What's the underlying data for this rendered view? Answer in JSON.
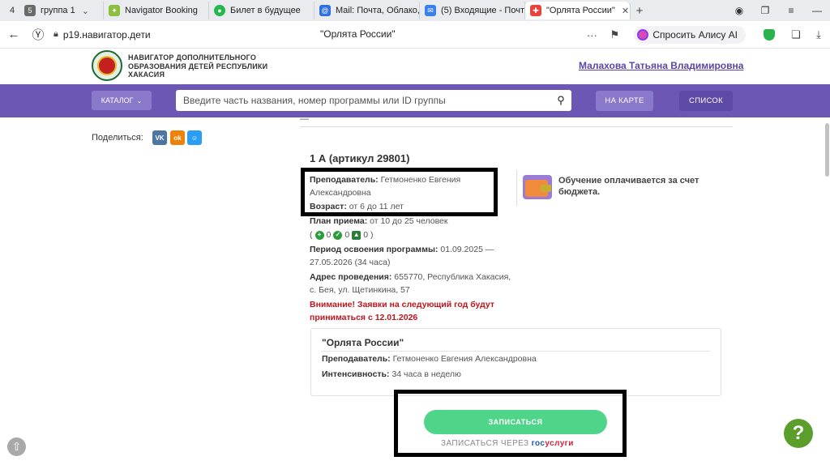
{
  "browser": {
    "tab_counter": "4",
    "tabs": [
      {
        "label": "группа 1",
        "badge": "5",
        "color": "#6a6a6a"
      },
      {
        "label": "Navigator Booking",
        "badge": "",
        "color": "#8bbf3c"
      },
      {
        "label": "Билет в будущее",
        "badge": "",
        "color": "#22b94a"
      },
      {
        "label": "Mail: Почта, Облако, К",
        "badge": "",
        "color": "#2f6fe5"
      },
      {
        "label": "(5) Входящие - Почта",
        "badge": "",
        "color": "#3b7fea"
      },
      {
        "label": "\"Орлята России\"",
        "badge": "",
        "color": "#e8443a"
      }
    ],
    "url": "p19.навигатор.дети",
    "page_title": "\"Орлята России\"",
    "alice_label": "Спросить Алису AI"
  },
  "header": {
    "org_name": "НАВИГАТОР ДОПОЛНИТЕЛЬНОГО\nОБРАЗОВАНИЯ ДЕТЕЙ РЕСПУБЛИКИ\nХАКАСИЯ",
    "user_name": "Малахова Татьяна Владимировна"
  },
  "nav": {
    "catalog_label": "КАТАЛОГ",
    "search_placeholder": "Введите часть названия, номер программы или ID группы",
    "map_label": "НА КАРТЕ",
    "list_label": "СПИСОК"
  },
  "share": {
    "label": "Поделиться:",
    "networks": [
      {
        "icon": "VK",
        "color": "#4c75a3"
      },
      {
        "icon": "ok",
        "color": "#ee8208"
      },
      {
        "icon": "☺",
        "color": "#2a9df4"
      }
    ]
  },
  "group": {
    "title": "1 А (артикул 29801)",
    "teacher_label": "Преподаватель:",
    "teacher": "Гетмоненко Евгения Александровна",
    "age_label": "Возраст:",
    "age": "от 6 до 11 лет",
    "plan_label": "План приема:",
    "plan": "от 10 до 25 человек",
    "plan_counts": [
      "0",
      "0",
      "0"
    ],
    "period_label": "Период освоения программы:",
    "period": "01.09.2025 — 27.05.2026 (34 часа)",
    "address_label": "Адрес проведения:",
    "address": "655770, Республика Хакасия, с. Бея, ул. Щетинкина, 57",
    "warning": "Внимание! Заявки на следующий год будут приниматься с 12.01.2026"
  },
  "payment": {
    "text": "Обучение оплачивается за счет бюджета."
  },
  "program_card": {
    "title": "\"Орлята России\"",
    "teacher_label": "Преподаватель:",
    "teacher": "Гетмоненко Евгения Александровна",
    "intensity_label": "Интенсивность:",
    "intensity": "34 часа в неделю"
  },
  "enroll": {
    "button_label": "ЗАПИСАТЬСЯ",
    "gos_prefix": "ЗАПИСАТЬСЯ ЧЕРЕЗ",
    "gos_part1": "гос",
    "gos_part2": "услуги"
  },
  "help_label": "?"
}
